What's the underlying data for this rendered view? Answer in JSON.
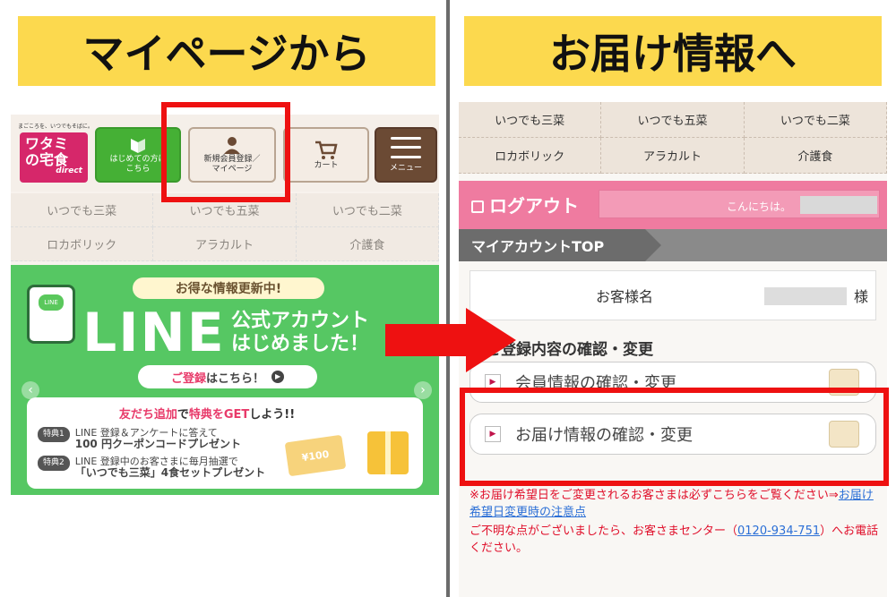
{
  "left_banner": {
    "title": "マイページから"
  },
  "right_banner": {
    "title": "お届け情報へ"
  },
  "left_page": {
    "tagline": "まごころを、いつでもそばに。",
    "logo": {
      "line1": "ワタミ",
      "line2": "の宅食",
      "sub": "direct"
    },
    "buttons": {
      "start_line1": "はじめての方は",
      "start_line2": "こちら",
      "register_line1": "新規会員登録／",
      "register_line2": "マイページ",
      "cart": "カート",
      "menu": "メニュー"
    },
    "subnav": [
      "いつでも三菜",
      "いつでも五菜",
      "いつでも二菜",
      "ロカボリック",
      "アラカルト",
      "介護食"
    ],
    "line_banner": {
      "pill": "お得な情報更新中!",
      "phone_label": "LINE",
      "word": "LINE",
      "official_line1": "公式アカウント",
      "official_line2": "はじめました！",
      "register_em": "ご登録",
      "register_rest": "はこちら！",
      "friend_em1": "友だち追加",
      "friend_mid": "で",
      "friend_em2": "特典をGET",
      "friend_end": "しよう!!",
      "perk1_tag": "特典1",
      "perk1_line1": "LINE 登録＆アンケートに答えて",
      "perk1_line2": "100 円クーポンコードプレゼント",
      "perk2_tag": "特典2",
      "perk2_line1": "LINE 登録中のお客さまに毎月抽選で",
      "perk2_line2": "「いつでも三菜」4食セットプレゼント",
      "coupon": "¥100"
    }
  },
  "right_page": {
    "nav": [
      "いつでも三菜",
      "いつでも五菜",
      "いつでも二菜",
      "ロカボリック",
      "アラカルト",
      "介護食"
    ],
    "logout": "ログアウト",
    "greeting": "こんにちは。",
    "account_top": "マイアカウントTOP",
    "customer_label": "お客様名",
    "honorific": "様",
    "section_title": "ご登録内容の確認・変更",
    "member_btn": "会員情報の確認・変更",
    "delivery_btn": "お届け情報の確認・変更",
    "note1": "※お届け希望日をご変更されるお客さまは必ずこちらをご覧ください⇒",
    "note1_link": "お届け希望日変更時の注意点",
    "note2_a": "ご不明な点がございましたら、お客さまセンター（",
    "phone": "0120-934-751",
    "note2_b": "）へお電話ください。"
  }
}
